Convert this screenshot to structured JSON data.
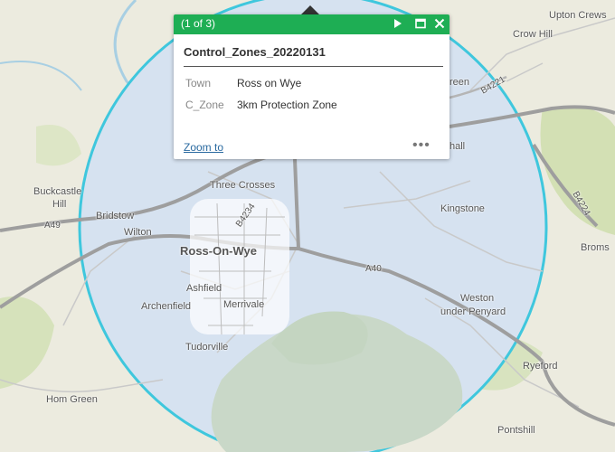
{
  "popup": {
    "count": "(1 of 3)",
    "title": "Control_Zones_20220131",
    "attributes": [
      {
        "key": "Town",
        "value": "Ross on Wye"
      },
      {
        "key": "C_Zone",
        "value": "3km Protection Zone"
      }
    ],
    "zoom_label": "Zoom to",
    "more_label": "•••"
  },
  "map": {
    "zone_fill": "#d6e2f0",
    "zone_outline": "#3fc7dd",
    "labels": {
      "ross_on_wye": "Ross-On-Wye",
      "three_crosses": "Three Crosses",
      "kingstone": "Kingstone",
      "bridstow": "Bridstow",
      "wilton": "Wilton",
      "buckcastle_hill_1": "Buckcastle",
      "buckcastle_hill_2": "Hill",
      "ashfield": "Ashfield",
      "archenfield": "Archenfield",
      "merrivale": "Merrivale",
      "tudorville": "Tudorville",
      "hom_green": "Hom Green",
      "weston_1": "Weston",
      "weston_2": "under Penyard",
      "ryeford": "Ryeford",
      "pontshill": "Pontshill",
      "upton_crews": "Upton Crews",
      "crow_hill": "Crow Hill",
      "green_partial": "reen",
      "hall_partial": "hall",
      "bromsash_partial": "Broms",
      "road_a49": "A49",
      "road_a40": "A40",
      "road_b4234": "B4234",
      "road_b4221": "B4221",
      "road_b4224": "B4224"
    }
  }
}
